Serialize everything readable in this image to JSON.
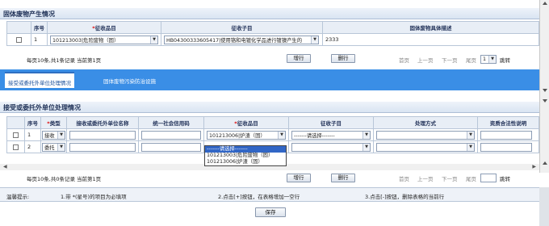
{
  "section1": {
    "title": "固体废物产生情况",
    "headers": [
      "序号",
      "征收品目",
      "征收子目",
      "固体废物具体描述"
    ],
    "row": {
      "index": "1",
      "item": "101213003|危险废物（固）",
      "subitem": "HB04300333605417|使用铬和电镀化学品进行镀镍产生的",
      "desc": "2333"
    },
    "add_label": "增行",
    "del_label": "删行",
    "pager_info": "每页10条,共1条记录 当前第1页",
    "first": "首页",
    "prev": "上一页",
    "next": "下一页",
    "last": "尾页",
    "page_select": "1",
    "jump": "跳转"
  },
  "tabs": [
    {
      "label": "接受或委托外单位处理情况"
    },
    {
      "label": "固体废物污染防治设施"
    }
  ],
  "section2": {
    "title": "接受或委托外单位处理情况",
    "headers": [
      "序号",
      "类型",
      "接收或委托外单位名称",
      "统一社会信用码",
      "征收品目",
      "征收子目",
      "处理方式",
      "资质合法性说明"
    ],
    "rows": [
      {
        "index": "1",
        "type": "接收",
        "item": "101213006|炉渣（固）",
        "subitem": "-------请选择-------"
      },
      {
        "index": "2",
        "type": "委托",
        "item": "",
        "subitem": ""
      }
    ],
    "dropdown_options": [
      "-------请选择-------",
      "101213003|危险废物（固）",
      "101213006|炉渣（固）"
    ],
    "add_label": "增行",
    "del_label": "删行",
    "pager_info": "每页10条,共0条记录 当前第1页",
    "first": "首页",
    "prev": "上一页",
    "next": "下一页",
    "last": "尾页",
    "page_select": "",
    "jump": "跳转"
  },
  "hint": {
    "label": "温馨提示:",
    "tip1": "1.带 *(星号)的项目为必填项",
    "tip2": "2.点击[+]按钮，在表格增加一空行",
    "tip3": "3.点击[-]按钮，删除表格的当前行"
  },
  "save_label": "保存"
}
